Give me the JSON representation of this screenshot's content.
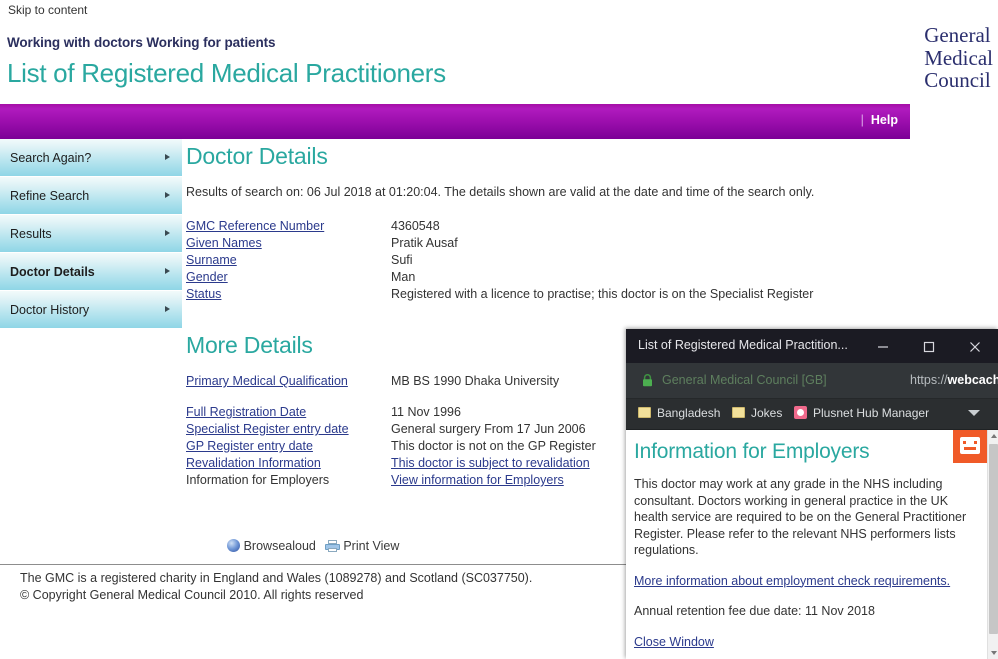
{
  "skip_link": "Skip to content",
  "header": {
    "tagline": "Working with doctors Working for patients",
    "site_title": "List of Registered Medical Practitioners",
    "logo_line1": "General",
    "logo_line2": "Medical",
    "logo_line3": "Council",
    "logo_color": "#2b3a8c"
  },
  "navbar": {
    "divider": "|",
    "help_label": "Help",
    "background_color": "#9d0fae"
  },
  "sidebar": {
    "items": [
      {
        "label": "Search Again?",
        "active": false
      },
      {
        "label": "Refine Search",
        "active": false
      },
      {
        "label": "Results",
        "active": false
      },
      {
        "label": "Doctor Details",
        "active": true
      },
      {
        "label": "Doctor History",
        "active": false
      }
    ]
  },
  "main": {
    "heading": "Doctor Details",
    "heading_color": "#2aa8a0",
    "search_note": "Results of search on: 06 Jul 2018 at 01:20:04. The details shown are valid at the date and time of the search only.",
    "details": [
      {
        "label": "GMC Reference Number",
        "label_is_link": true,
        "value": "4360548",
        "value_is_link": false
      },
      {
        "label": "Given Names",
        "label_is_link": true,
        "value": "Pratik Ausaf",
        "value_is_link": false
      },
      {
        "label": "Surname",
        "label_is_link": true,
        "value": "Sufi",
        "value_is_link": false
      },
      {
        "label": "Gender",
        "label_is_link": true,
        "value": "Man",
        "value_is_link": false
      },
      {
        "label": "Status",
        "label_is_link": true,
        "value": "Registered with a licence to practise; this doctor is on the Specialist Register",
        "value_is_link": false
      }
    ],
    "more_heading": "More Details",
    "more_details": [
      {
        "label": "Primary Medical Qualification",
        "label_is_link": true,
        "value": "MB BS 1990 Dhaka University",
        "value_is_link": false
      },
      {
        "label": "Full Registration Date",
        "label_is_link": true,
        "value": "11 Nov 1996",
        "value_is_link": false
      },
      {
        "label": "Specialist Register entry date",
        "label_is_link": true,
        "value": "General surgery From 17 Jun 2006",
        "value_is_link": false
      },
      {
        "label": "GP Register entry date",
        "label_is_link": true,
        "value": "This doctor is not on the GP Register",
        "value_is_link": false
      },
      {
        "label": "Revalidation Information",
        "label_is_link": true,
        "value": "This doctor is subject to revalidation",
        "value_is_link": true
      },
      {
        "label": "Information for Employers",
        "label_is_link": false,
        "value": "View information for Employers",
        "value_is_link": true
      }
    ]
  },
  "tools": {
    "browsealoud_label": "Browsealoud",
    "browsealoud_icon": "browsealoud-icon",
    "print_label": "Print View",
    "print_icon": "printer-icon"
  },
  "footer": {
    "line1": "The GMC is a registered charity in England and Wales (1089278) and Scotland (SC037750).",
    "line2": "© Copyright General Medical Council 2010. All rights reserved"
  },
  "popup": {
    "window_title": "List of Registered Medical Practition...",
    "minimize_icon": "minimize-icon",
    "maximize_icon": "maximize-icon",
    "close_icon": "close-icon",
    "lock_icon": "lock-icon",
    "site_identity": "General Medical Council [GB]",
    "url_prefix": "https://",
    "url_domain": "webcache.gmc-uk.",
    "bookmarks": [
      {
        "label": "Bangladesh",
        "icon": "folder-icon"
      },
      {
        "label": "Jokes",
        "icon": "folder-icon"
      },
      {
        "label": "Plusnet Hub Manager",
        "icon": "plusnet-icon"
      }
    ],
    "bookmarks_overflow_icon": "chevron-down-icon",
    "heading": "Information for Employers",
    "body": "This doctor may work at any grade in the NHS including consultant. Doctors working in general practice in the UK health service are required to be on the General Practitioner Register. Please refer to the relevant NHS performers lists regulations.",
    "more_info_link": "More information about employment check requirements.",
    "fee_text": "Annual retention fee due date: 11 Nov 2018",
    "close_link": "Close Window",
    "badge_icon": "robot-face-icon",
    "badge_color": "#f05a28"
  }
}
